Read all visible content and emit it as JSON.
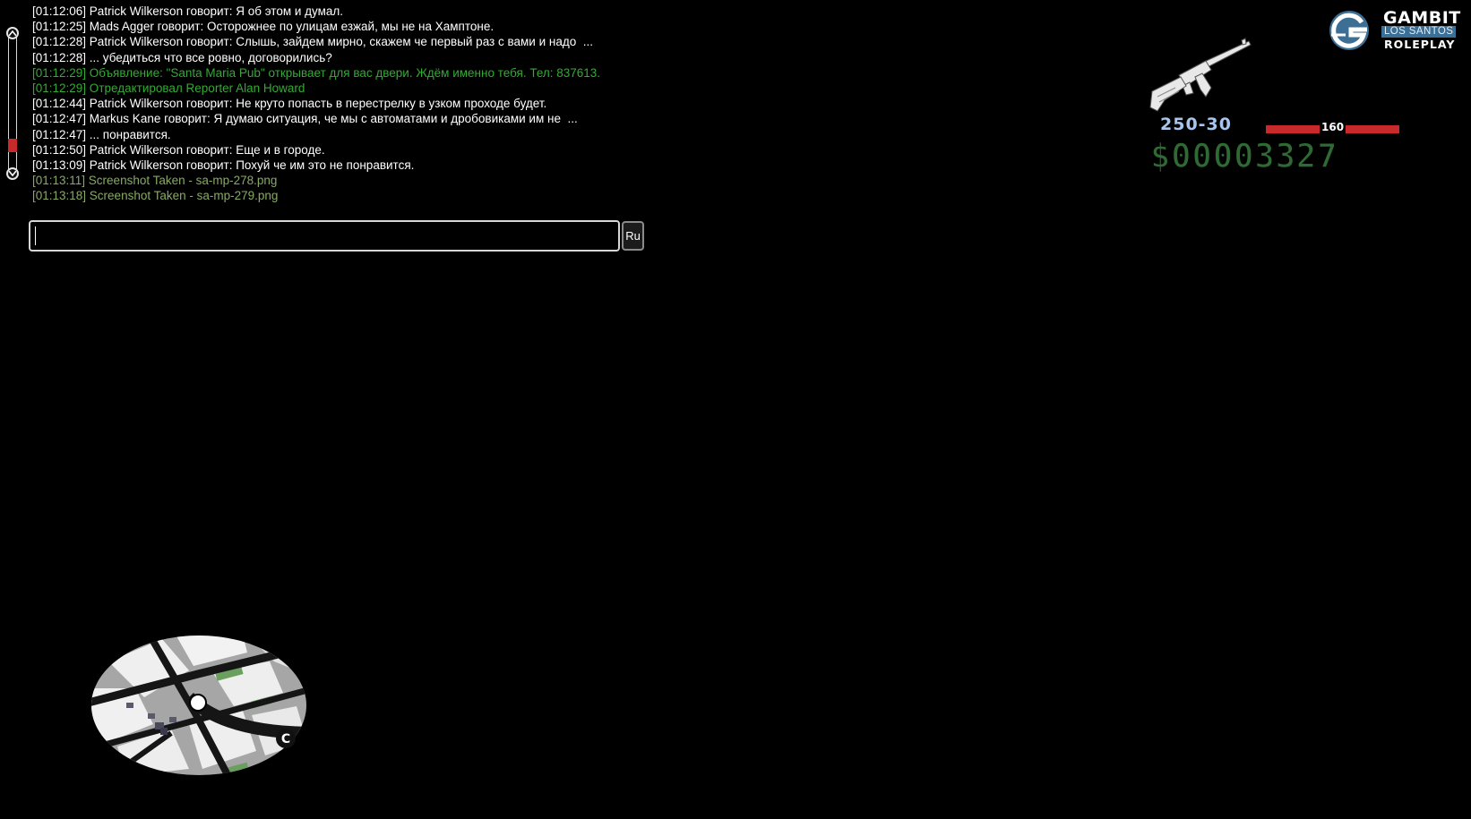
{
  "chat": {
    "lines": [
      {
        "text": "[01:12:06] Patrick Wilkerson говорит: Я об этом и думал.",
        "kind": "normal"
      },
      {
        "text": "[01:12:25] Mads Agger говорит: Осторожнее по улицам езжай, мы не на Хамптоне.",
        "kind": "normal"
      },
      {
        "text": "[01:12:28] Patrick Wilkerson говорит: Слышь, зайдем мирно, скажем че первый раз с вами и надо  ...",
        "kind": "normal"
      },
      {
        "text": "[01:12:28] ... убедиться что все ровно, договорились?",
        "kind": "normal"
      },
      {
        "text": "[01:12:29] Объявление: \"Santa Maria Pub\" открывает для вас двери. Ждём именно тебя. Тел: 837613.",
        "kind": "ad"
      },
      {
        "text": "[01:12:29] Отредактировал Reporter Alan Howard",
        "kind": "ad"
      },
      {
        "text": "[01:12:44] Patrick Wilkerson говорит: Не круто попасть в перестрелку в узком проходе будет.",
        "kind": "normal"
      },
      {
        "text": "[01:12:47] Markus Kane говорит: Я думаю ситуация, че мы с автоматами и дробовиками им не  ...",
        "kind": "normal"
      },
      {
        "text": "[01:12:47] ... понравится.",
        "kind": "normal"
      },
      {
        "text": "[01:12:50] Patrick Wilkerson говорит: Еще и в городе.",
        "kind": "normal"
      },
      {
        "text": "[01:13:09] Patrick Wilkerson говорит: Похуй че им это не понравится.",
        "kind": "normal"
      },
      {
        "text": "[01:13:11] Screenshot Taken - sa-mp-278.png",
        "kind": "sys"
      },
      {
        "text": "[01:13:18] Screenshot Taken - sa-mp-279.png",
        "kind": "sys"
      }
    ],
    "input_value": "",
    "language_button": "Ru",
    "scroll_position": 0.85
  },
  "logo": {
    "name": "GAMBIT",
    "city": "LOS SANTOS",
    "tagline": "ROLEPLAY",
    "emblem_icon": "gambit-emblem-icon"
  },
  "hud": {
    "weapon_icon": "ak47-icon",
    "ammo": "250-30",
    "health_value": "160",
    "health_fraction": 1.0,
    "money": "$00003327",
    "colors": {
      "chat_text": "#ffffff",
      "chat_ad": "#33aa33",
      "chat_system": "#88aa62",
      "health": "#c82a2c",
      "money": "#2f6a34",
      "ammo": "#a8c6ec"
    }
  },
  "radar": {
    "compass_label": "C"
  }
}
